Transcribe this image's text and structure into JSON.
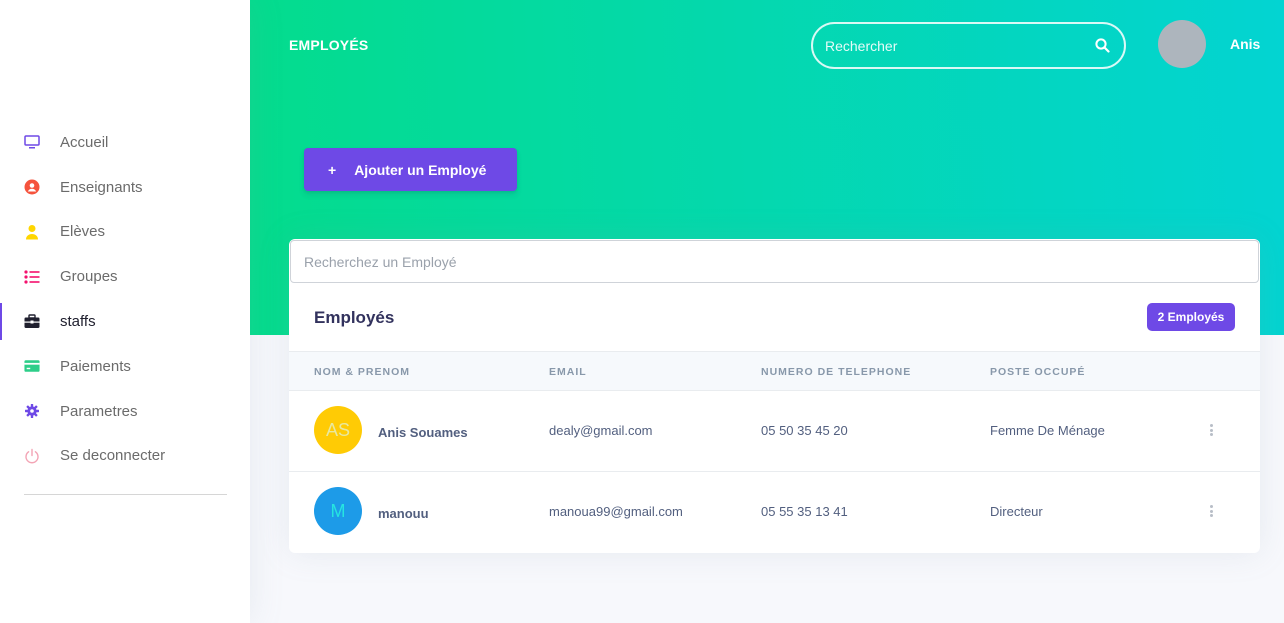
{
  "header": {
    "title": "EMPLOYÉS",
    "search_placeholder": "Rechercher",
    "user_name": "Anis"
  },
  "sidebar": {
    "items": [
      {
        "label": "Accueil",
        "icon": "monitor-icon",
        "color": "#6e49e6"
      },
      {
        "label": "Enseignants",
        "icon": "user-circle-icon",
        "color": "#f5533d"
      },
      {
        "label": "Elèves",
        "icon": "user-icon",
        "color": "#ffd600"
      },
      {
        "label": "Groupes",
        "icon": "list-icon",
        "color": "#f3116d"
      },
      {
        "label": "staffs",
        "icon": "briefcase-icon",
        "color": "#1f1f2e",
        "active": true
      },
      {
        "label": "Paiements",
        "icon": "credit-card-icon",
        "color": "#2dce89"
      },
      {
        "label": "Parametres",
        "icon": "gear-icon",
        "color": "#6e49e6"
      },
      {
        "label": "Se deconnecter",
        "icon": "power-icon",
        "color": "#f3a4b5"
      }
    ]
  },
  "actions": {
    "add_label": "Ajouter un Employé",
    "add_icon": "+"
  },
  "card": {
    "search_placeholder": "Recherchez un Employé",
    "title": "Employés",
    "badge": "2 Employés",
    "columns": [
      "NOM & PRENOM",
      "EMAIL",
      "NUMERO DE TELEPHONE",
      "POSTE OCCUPÉ"
    ],
    "rows": [
      {
        "initials": "AS",
        "avatar_color": "#ffcb05",
        "initials_color": "#e8e8a0",
        "name": "Anis Souames",
        "email": "dealy@gmail.com",
        "phone": "05 50 35 45 20",
        "poste": "Femme De Ménage"
      },
      {
        "initials": "M",
        "avatar_color": "#1d9be8",
        "initials_color": "#26e5e0",
        "name": "manouu",
        "email": "manoua99@gmail.com",
        "phone": "05 55 35 13 41",
        "poste": "Directeur"
      }
    ]
  },
  "colors": {
    "accent": "#6e49e6",
    "gradient_start": "#04dc8c",
    "gradient_end": "#03d4d2"
  }
}
